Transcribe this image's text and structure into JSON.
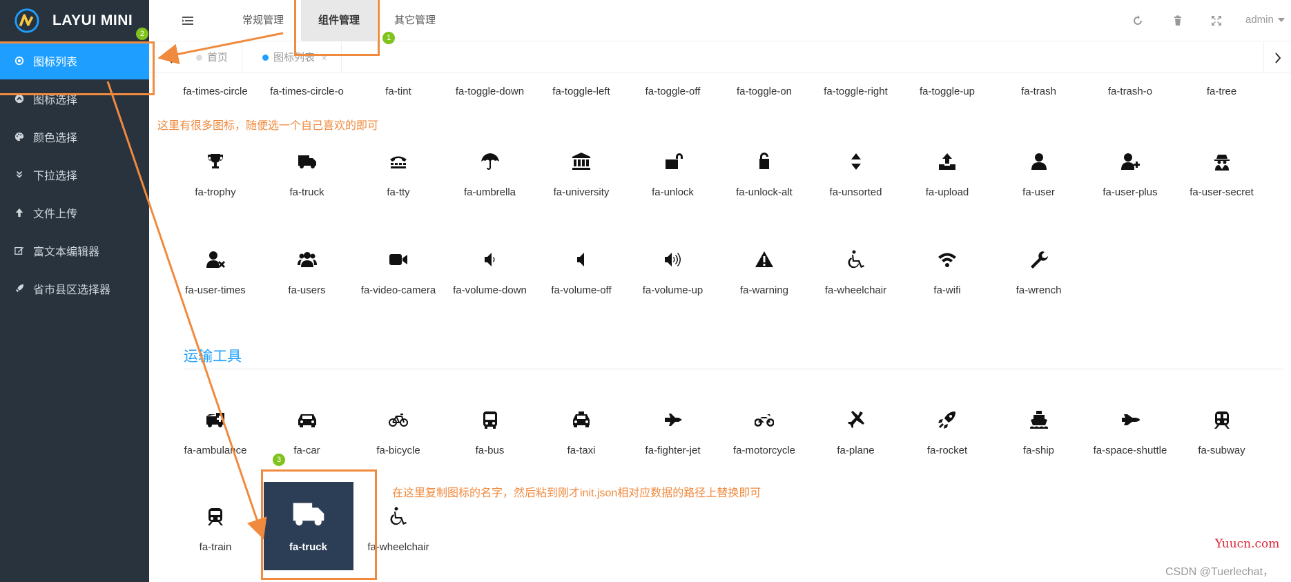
{
  "app": {
    "title": "LAYUI MINI"
  },
  "sidebar": {
    "items": [
      {
        "label": "图标列表",
        "icon": "target-icon",
        "active": true
      },
      {
        "label": "图标选择",
        "icon": "circle-up-icon"
      },
      {
        "label": "颜色选择",
        "icon": "palette-icon"
      },
      {
        "label": "下拉选择",
        "icon": "double-chevron-down-icon"
      },
      {
        "label": "文件上传",
        "icon": "arrow-up-icon"
      },
      {
        "label": "富文本编辑器",
        "icon": "edit-icon"
      },
      {
        "label": "省市县区选择器",
        "icon": "rocket-icon"
      }
    ]
  },
  "header": {
    "tabs": [
      "常规管理",
      "组件管理",
      "其它管理"
    ],
    "active_tab": "组件管理",
    "user": "admin"
  },
  "tabbar": {
    "tabs": [
      {
        "label": "首页"
      },
      {
        "label": "图标列表",
        "close": "×"
      }
    ]
  },
  "icons_top_names": [
    "fa-times-circle",
    "fa-times-circle-o",
    "fa-tint",
    "fa-toggle-down",
    "fa-toggle-left",
    "fa-toggle-off",
    "fa-toggle-on",
    "fa-toggle-right",
    "fa-toggle-up",
    "fa-trash",
    "fa-trash-o",
    "fa-tree"
  ],
  "icons_row1": [
    "fa-trophy",
    "fa-truck",
    "fa-tty",
    "fa-umbrella",
    "fa-university",
    "fa-unlock",
    "fa-unlock-alt",
    "fa-unsorted",
    "fa-upload",
    "fa-user",
    "fa-user-plus",
    "fa-user-secret"
  ],
  "icons_row2": [
    "fa-user-times",
    "fa-users",
    "fa-video-camera",
    "fa-volume-down",
    "fa-volume-off",
    "fa-volume-up",
    "fa-warning",
    "fa-wheelchair",
    "fa-wifi",
    "fa-wrench"
  ],
  "section": {
    "title": "运输工具"
  },
  "icons_row3": [
    "fa-ambulance",
    "fa-car",
    "fa-bicycle",
    "fa-bus",
    "fa-taxi",
    "fa-fighter-jet",
    "fa-motorcycle",
    "fa-plane",
    "fa-rocket",
    "fa-ship",
    "fa-space-shuttle",
    "fa-subway"
  ],
  "icons_row4": [
    "fa-train",
    "fa-truck",
    "fa-wheelchair"
  ],
  "annotations": {
    "note1": "这里有很多图标，随便选一个自己喜欢的即可",
    "note2": "在这里复制图标的名字，然后粘到刚才init.json相对应数据的路径上替换即可",
    "badges": [
      "1",
      "2",
      "3"
    ],
    "accent": "#f08a3e"
  },
  "watermark": {
    "site": "Yuucn.com",
    "credit": "CSDN @Tuerlechat，"
  },
  "colors": {
    "sidebar_bg": "#28333e",
    "active_blue": "#1e9fff",
    "selected_bg": "#2c3e56"
  }
}
